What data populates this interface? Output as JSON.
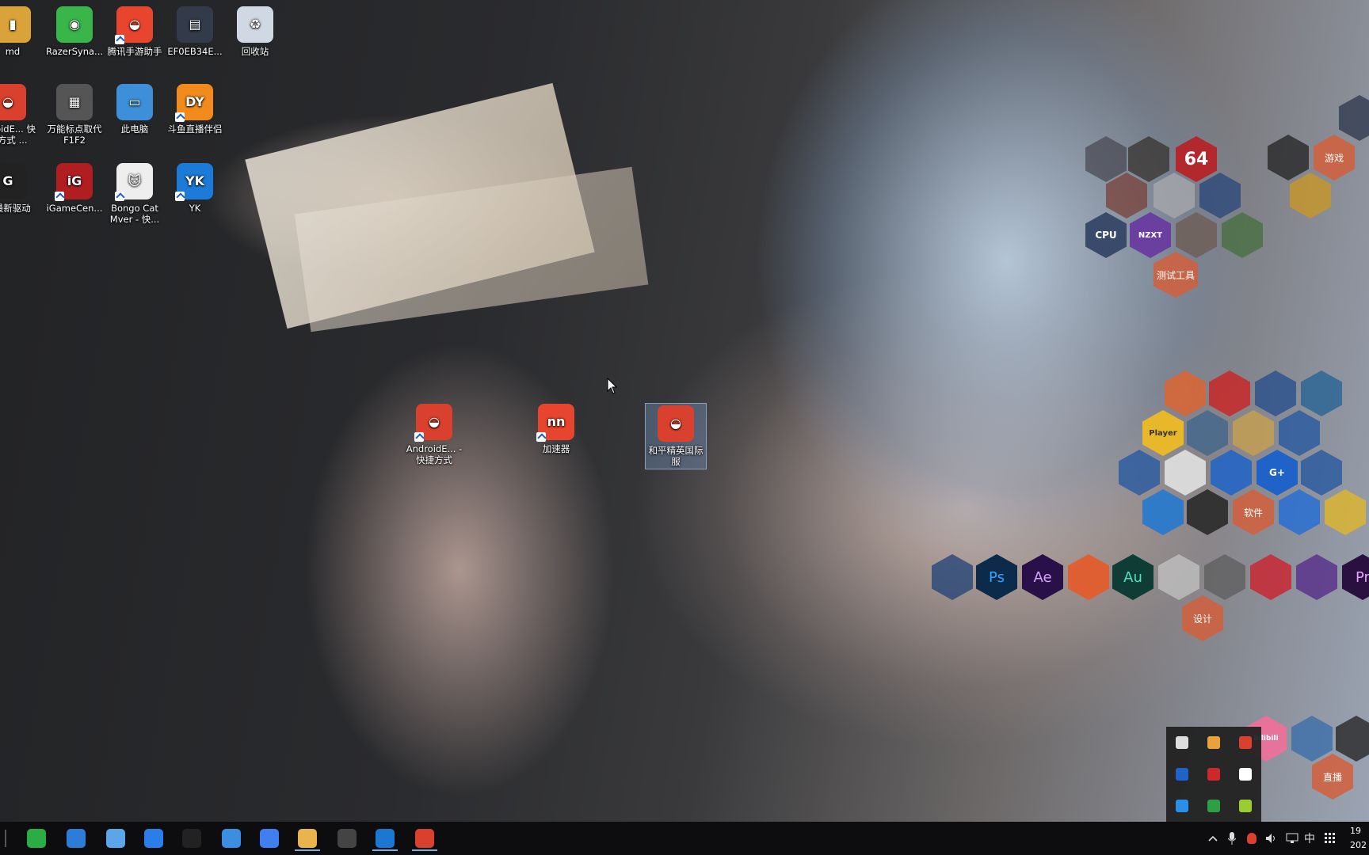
{
  "desktop_icons": [
    {
      "id": "md",
      "label": "md",
      "color": "#d9a33a",
      "symbol": "▮",
      "shortcut": false
    },
    {
      "id": "razer",
      "label": "RazerSyna...",
      "color": "#3ab54a",
      "symbol": "◉",
      "shortcut": false
    },
    {
      "id": "tencent-assistant",
      "label": "腾讯手游助手",
      "color": "#e8452f",
      "symbol": "◒",
      "shortcut": true
    },
    {
      "id": "ef0eb34e",
      "label": "EF0EB34E...",
      "color": "#333a4a",
      "symbol": "▤",
      "shortcut": false
    },
    {
      "id": "recycle-bin",
      "label": "回收站",
      "color": "#cfd8e3",
      "symbol": "♻",
      "shortcut": false
    },
    {
      "id": "android-emu-top",
      "label": "ndroidE... 快捷方式 ...",
      "color": "#d9412e",
      "symbol": "◒",
      "shortcut": true
    },
    {
      "id": "wanneng",
      "label": "万能标点取代 F1F2",
      "color": "#555555",
      "symbol": "▦",
      "shortcut": false
    },
    {
      "id": "this-pc",
      "label": "此电脑",
      "color": "#3c8fd8",
      "symbol": "▭",
      "shortcut": false
    },
    {
      "id": "douyu",
      "label": "斗鱼直播伴侣",
      "color": "#f28a1c",
      "symbol": "DY",
      "shortcut": true
    },
    {
      "id": "logitech",
      "label": "技最新驱动",
      "color": "#222222",
      "symbol": "G",
      "shortcut": true
    },
    {
      "id": "igamecenter",
      "label": "iGameCen...",
      "color": "#b01e22",
      "symbol": "iG",
      "shortcut": true
    },
    {
      "id": "bongo-cat",
      "label": "Bongo Cat Mver - 快...",
      "color": "#eeeeee",
      "symbol": "🐱",
      "shortcut": true
    },
    {
      "id": "yk",
      "label": "YK",
      "color": "#1c7ad8",
      "symbol": "YK",
      "shortcut": true
    },
    {
      "id": "android-emu-mid",
      "label": "AndroidE... - 快捷方式",
      "color": "#d9412e",
      "symbol": "◒",
      "shortcut": true
    },
    {
      "id": "accelerator",
      "label": "加速器",
      "color": "#e8452f",
      "symbol": "nn",
      "shortcut": true
    },
    {
      "id": "hpjy",
      "label": "和平精英国际服",
      "color": "#d9412e",
      "symbol": "◒",
      "shortcut": false
    }
  ],
  "hex_groups": {
    "games_label": "游戏",
    "test_label": "测试工具",
    "software_label": "软件",
    "design_label": "设计",
    "live_label": "直播"
  },
  "hex_icons": [
    {
      "id": "hex-aida64",
      "text": "64",
      "color": "#b3282d"
    },
    {
      "id": "hex-cpu",
      "text": "CPU",
      "color": "#3a4a6a"
    },
    {
      "id": "hex-nzxt",
      "text": "NZXT",
      "color": "#6b3fa0"
    },
    {
      "id": "hex-photoshop",
      "text": "Ps",
      "color": "#0c2a4a"
    },
    {
      "id": "hex-aftereffects",
      "text": "Ae",
      "color": "#2a1048"
    },
    {
      "id": "hex-audition",
      "text": "Au",
      "color": "#0f3d35"
    },
    {
      "id": "hex-premiere",
      "text": "Pr",
      "color": "#2a1040"
    },
    {
      "id": "hex-player",
      "text": "Player",
      "color": "#e9b72a"
    },
    {
      "id": "hex-gplus",
      "text": "G+",
      "color": "#1f63c9"
    },
    {
      "id": "hex-bilibili",
      "text": "bilibili",
      "color": "#e7729a"
    }
  ],
  "taskbar_icons": [
    {
      "id": "wechat",
      "color": "#2aae43",
      "running": false
    },
    {
      "id": "app-2",
      "color": "#2d7dd8",
      "running": false
    },
    {
      "id": "app-3",
      "color": "#5aa6e8",
      "running": false
    },
    {
      "id": "sogou",
      "color": "#2b7de9",
      "running": false
    },
    {
      "id": "qq",
      "color": "#222222",
      "running": false
    },
    {
      "id": "app-6",
      "color": "#3b8ee0",
      "running": false
    },
    {
      "id": "feishu",
      "color": "#3f7ff0",
      "running": false
    },
    {
      "id": "file-explorer",
      "color": "#e9b44c",
      "running": true
    },
    {
      "id": "obs",
      "color": "#444444",
      "running": false
    },
    {
      "id": "ykid",
      "color": "#1b77d2",
      "running": true
    },
    {
      "id": "hpjy-task",
      "color": "#d9412e",
      "running": true
    }
  ],
  "tray_popup": [
    "#dddddd",
    "#e9a23b",
    "#d9412e",
    "#1f63c9",
    "#cc2a2a",
    "#ffffff",
    "#2b8ee8",
    "#2f9e44",
    "#9acd32"
  ],
  "system_tray": {
    "ime": "中",
    "clock_time": "19",
    "clock_date": "202"
  }
}
